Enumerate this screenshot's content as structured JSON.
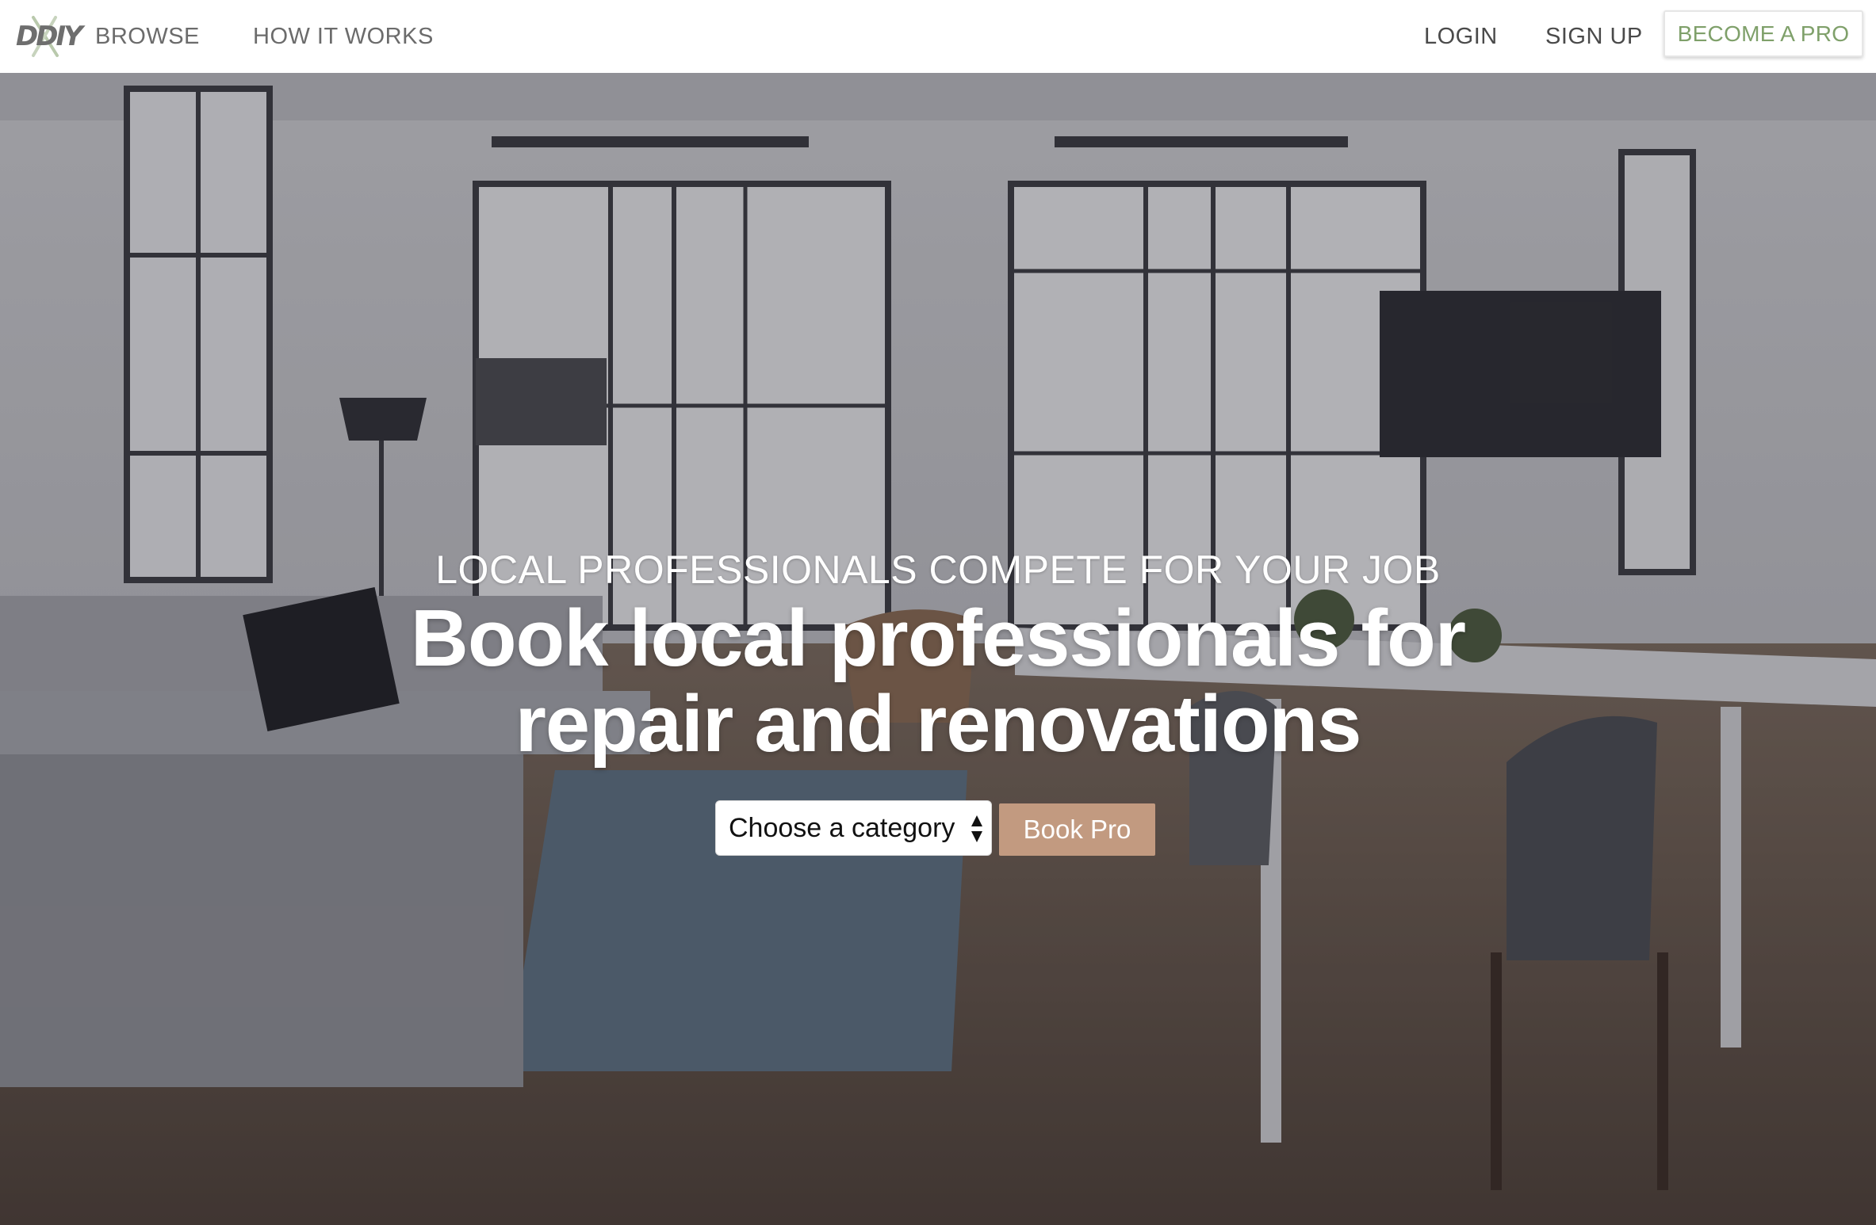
{
  "nav": {
    "logo_text": "DDIY",
    "browse": "BROWSE",
    "how_it_works": "HOW IT WORKS",
    "login": "LOGIN",
    "sign_up": "SIGN UP",
    "become_pro": "BECOME A PRO"
  },
  "hero": {
    "eyebrow": "LOCAL PROFESSIONALS COMPETE FOR YOUR JOB",
    "title_line1": "Book local professionals for",
    "title_line2": "repair and renovations",
    "category_placeholder": "Choose a category",
    "book_button": "Book Pro"
  },
  "colors": {
    "accent_green": "#7fa06a",
    "book_button": "#c29a80"
  }
}
